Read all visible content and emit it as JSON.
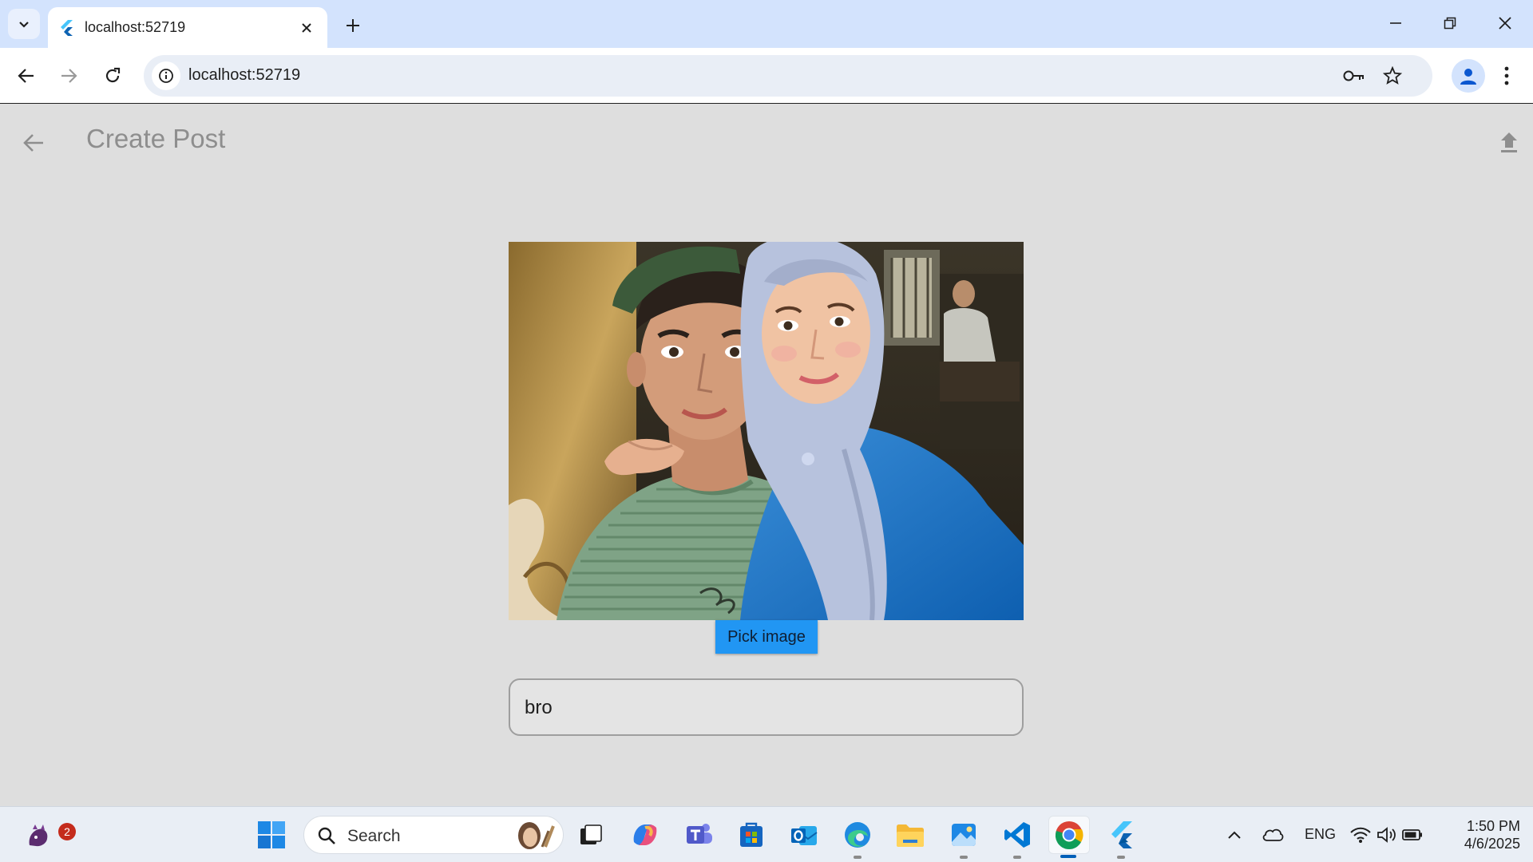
{
  "browser": {
    "tab_title": "localhost:52719",
    "url": "localhost:52719"
  },
  "app": {
    "title": "Create Post",
    "pick_image_label": "Pick image",
    "caption_value": "bro",
    "colors": {
      "background": "#dedede",
      "button": "#2196f3"
    }
  },
  "taskbar": {
    "search_placeholder": "Search",
    "notification_count": "2",
    "language": "ENG",
    "time": "1:50 PM",
    "date": "4/6/2025"
  }
}
